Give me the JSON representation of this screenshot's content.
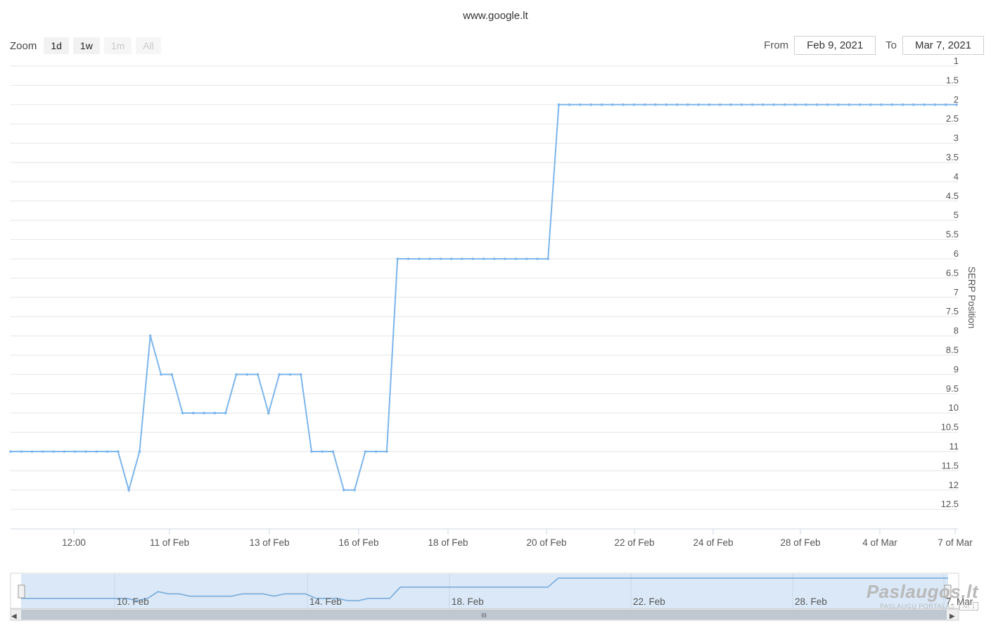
{
  "title": "www.google.lt",
  "zoom": {
    "label": "Zoom",
    "buttons": [
      {
        "label": "1d",
        "enabled": true
      },
      {
        "label": "1w",
        "enabled": true
      },
      {
        "label": "1m",
        "enabled": false
      },
      {
        "label": "All",
        "enabled": false
      }
    ]
  },
  "range": {
    "from_label": "From",
    "from_value": "Feb 9, 2021",
    "to_label": "To",
    "to_value": "Mar 7, 2021"
  },
  "colors": {
    "series": "#7cb5ec",
    "grid": "#e6e6e6",
    "navigator_fill": "#dbe8f7",
    "navigator_line": "#6fa8dc"
  },
  "chart_data": {
    "type": "line",
    "ylabel": "SERP Position",
    "y_reversed": true,
    "ylim": [
      1,
      12.5
    ],
    "y_ticks": [
      "1",
      "1.5",
      "2",
      "2.5",
      "3",
      "3.5",
      "4",
      "4.5",
      "5",
      "5.5",
      "6",
      "6.5",
      "7",
      "7.5",
      "8",
      "8.5",
      "9",
      "9.5",
      "10",
      "10.5",
      "11",
      "11.5",
      "12",
      "12.5"
    ],
    "x_ticks": [
      "12:00",
      "11 of Feb",
      "13 of Feb",
      "16 of Feb",
      "18 of Feb",
      "20 of Feb",
      "22 of Feb",
      "24 of Feb",
      "28 of Feb",
      "4 of Mar",
      "7 of Mar"
    ],
    "series": [
      {
        "values": [
          11,
          11,
          11,
          11,
          11,
          11,
          11,
          11,
          11,
          11,
          11,
          12,
          11,
          8,
          9,
          9,
          10,
          10,
          10,
          10,
          10,
          9,
          9,
          9,
          10,
          9,
          9,
          9,
          11,
          11,
          11,
          12,
          12,
          11,
          11,
          11,
          6,
          6,
          6,
          6,
          6,
          6,
          6,
          6,
          6,
          6,
          6,
          6,
          6,
          6,
          6,
          2,
          2,
          2,
          2,
          2,
          2,
          2,
          2,
          2,
          2,
          2,
          2,
          2,
          2,
          2,
          2,
          2,
          2,
          2,
          2,
          2,
          2,
          2,
          2,
          2,
          2,
          2,
          2,
          2,
          2,
          2,
          2,
          2,
          2,
          2,
          2,
          2,
          2
        ]
      }
    ]
  },
  "navigator": {
    "labels": [
      "10. Feb",
      "14. Feb",
      "18. Feb",
      "22. Feb",
      "28. Feb",
      "7. Mar"
    ],
    "scroll_grip": "III"
  },
  "watermark": {
    "brand": "Paslaugos.lt",
    "tagline": "PASLAUGŲ PORTALAS",
    "badge": "Nr.1"
  }
}
